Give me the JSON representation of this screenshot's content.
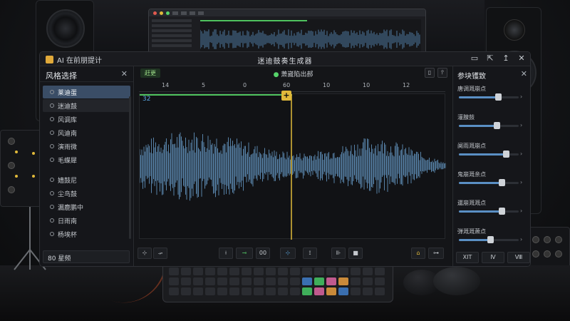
{
  "window": {
    "app_name": "AI 在前朋提计",
    "title": "迷迪鼓奏生成器",
    "controls": [
      "▭",
      "⇱",
      "↥",
      "✕"
    ]
  },
  "left_panel": {
    "title": "风格选择",
    "close": "✕",
    "items": [
      "莱迪蛋",
      "迷迪鼓",
      "风调库",
      "风迪南",
      "演雨微",
      "毛蝶犀",
      "嫱鼓尼",
      "尘鸟鼓",
      "漏鹿鹏中",
      "日雨南",
      "杨埃杯"
    ],
    "selected_index": 0,
    "footer": "80 星频"
  },
  "center": {
    "tag": "赶更",
    "status_dot": "●",
    "status": "萧崴陷出郝",
    "tools": [
      "▯",
      "⫯"
    ],
    "ruler": [
      "14",
      "5",
      "0",
      "60",
      "10",
      "10",
      "12"
    ],
    "track_number": "32",
    "playhead_icon": "+",
    "bottom_controls": [
      "⊹",
      "⤞",
      "⟊",
      "⊸",
      "00",
      "⊹",
      "⟟",
      "⊪",
      "■",
      "⌂",
      "⊶"
    ]
  },
  "right_panel": {
    "title": "参块镬致",
    "close": "✕",
    "params": [
      {
        "label": "唐调溉崩点",
        "value": 0.65
      },
      {
        "label": "灌腺鼓",
        "value": 0.63
      },
      {
        "label": "阒雨溉崩点",
        "value": 0.78
      },
      {
        "label": "鬼崩溉亲点",
        "value": 0.72
      },
      {
        "label": "邋崩溉溉点",
        "value": 0.72
      },
      {
        "label": "弹溉溉萧点",
        "value": 0.52
      }
    ],
    "slider_end": "›",
    "buttons": [
      "XIT",
      "Ⅳ",
      "Ⅷ"
    ]
  },
  "colors": {
    "accent": "#e0b93a",
    "waveform": "#5f8fb8",
    "selection": "#3a4d66",
    "status_green": "#56d36a"
  },
  "icons": {
    "app_logo": "folder-icon",
    "playhead": "plus-icon"
  }
}
